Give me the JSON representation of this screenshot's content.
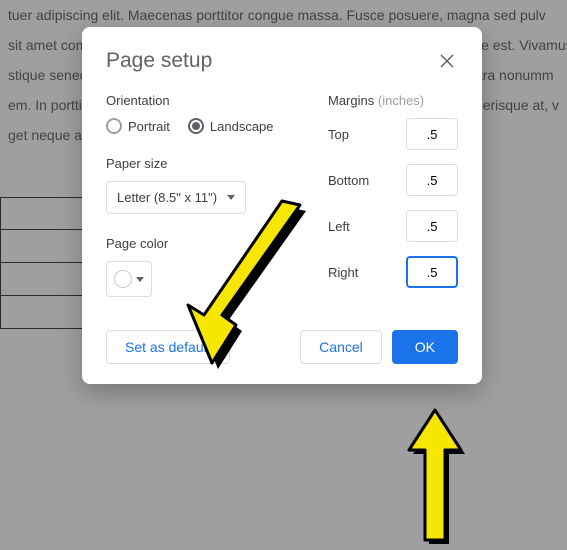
{
  "bg": {
    "line1": "tuer adipiscing elit. Maecenas porttitor congue massa. Fusce posuere, magna sed pulv",
    "line2": " sit amet commodo magna eros quis uma. Nunc viverra imperdiet enim. Fusce est. Vivamus",
    "line3": "stique senectus et netus et malesuada fames ac turpis egestas. Proin pharetra nonumm",
    "line4": "em. In porttitor. Donec laoreet nonummy augue. Suspendisse dui purus, scelerisque at, v",
    "line5": "get neque at sem venenatis eleifend. Ut nonummy."
  },
  "dialog": {
    "title": "Page setup",
    "orientation": {
      "label": "Orientation",
      "portrait": "Portrait",
      "landscape": "Landscape",
      "selected": "landscape"
    },
    "paper": {
      "label": "Paper size",
      "value": "Letter (8.5\" x 11\")"
    },
    "color": {
      "label": "Page color",
      "swatch": "#ffffff"
    },
    "margins": {
      "label": "Margins",
      "hint": "(inches)",
      "top_label": "Top",
      "top_value": ".5",
      "bottom_label": "Bottom",
      "bottom_value": ".5",
      "left_label": "Left",
      "left_value": ".5",
      "right_label": "Right",
      "right_value": ".5"
    },
    "buttons": {
      "set_default": "Set as default",
      "cancel": "Cancel",
      "ok": "OK"
    }
  }
}
